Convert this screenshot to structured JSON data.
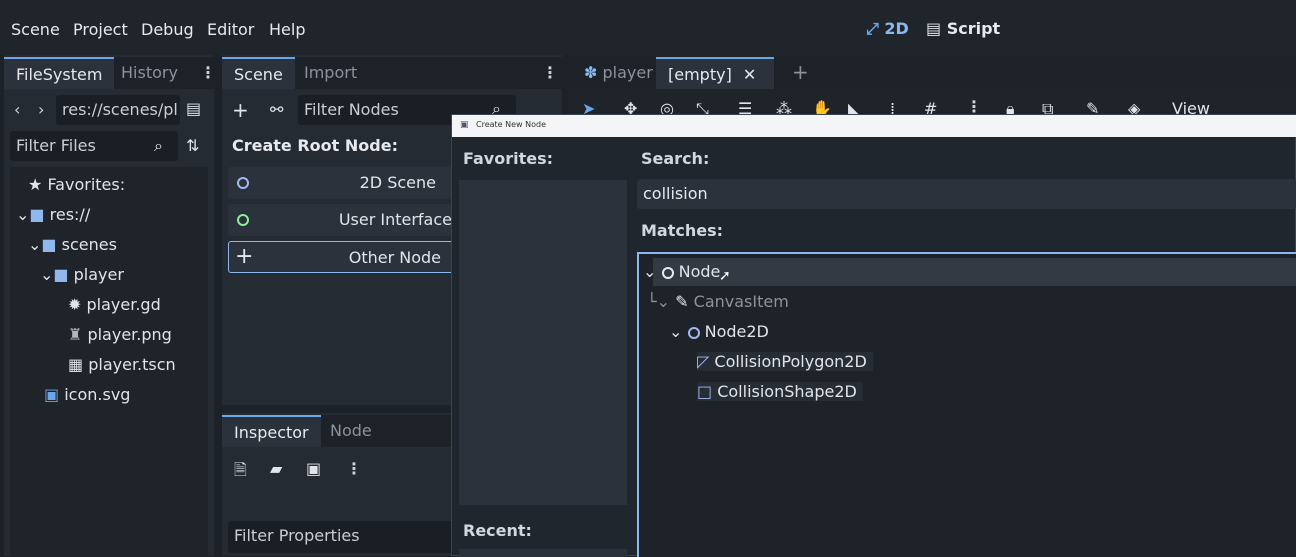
{
  "menu": [
    "Scene",
    "Project",
    "Debug",
    "Editor",
    "Help"
  ],
  "modes": {
    "two_d": "2D",
    "script": "Script"
  },
  "left_panel": {
    "tabs": [
      "FileSystem",
      "History"
    ],
    "path": "res://scenes/pl",
    "filter_placeholder": "Filter Files",
    "tree": [
      {
        "label": "Favorites:",
        "icon": "star-icon"
      },
      {
        "label": "res://",
        "icon": "folder-icon"
      },
      {
        "label": "scenes",
        "icon": "folder-icon"
      },
      {
        "label": "player",
        "icon": "folder-icon"
      },
      {
        "label": "player.gd",
        "icon": "gear-icon"
      },
      {
        "label": "player.png",
        "icon": "image-icon"
      },
      {
        "label": "player.tscn",
        "icon": "clapperboard-icon"
      },
      {
        "label": "icon.svg",
        "icon": "image-icon"
      }
    ]
  },
  "scene_panel": {
    "tabs": [
      "Scene",
      "Import"
    ],
    "filter_placeholder": "Filter Nodes",
    "create_root_label": "Create Root Node:",
    "root_options": [
      "2D Scene",
      "User Interface",
      "Other Node"
    ]
  },
  "inspector_panel": {
    "tabs": [
      "Inspector",
      "Node"
    ],
    "filter_placeholder": "Filter Properties"
  },
  "editor_tabs": [
    "player",
    "[empty]"
  ],
  "viewport_toolbar": {
    "view_label": "View"
  },
  "dialog": {
    "title": "Create New Node",
    "favorites_label": "Favorites:",
    "recent_label": "Recent:",
    "search_label": "Search:",
    "search_value": "collision",
    "matches_label": "Matches:",
    "matches": [
      "Node",
      "CanvasItem",
      "Node2D",
      "CollisionPolygon2D",
      "CollisionShape2D"
    ]
  },
  "colors": {
    "accent": "#6aa6e8",
    "node_ring": "#e6e9ee",
    "node2d": "#a5b7f3",
    "ui_node": "#8eef97"
  }
}
